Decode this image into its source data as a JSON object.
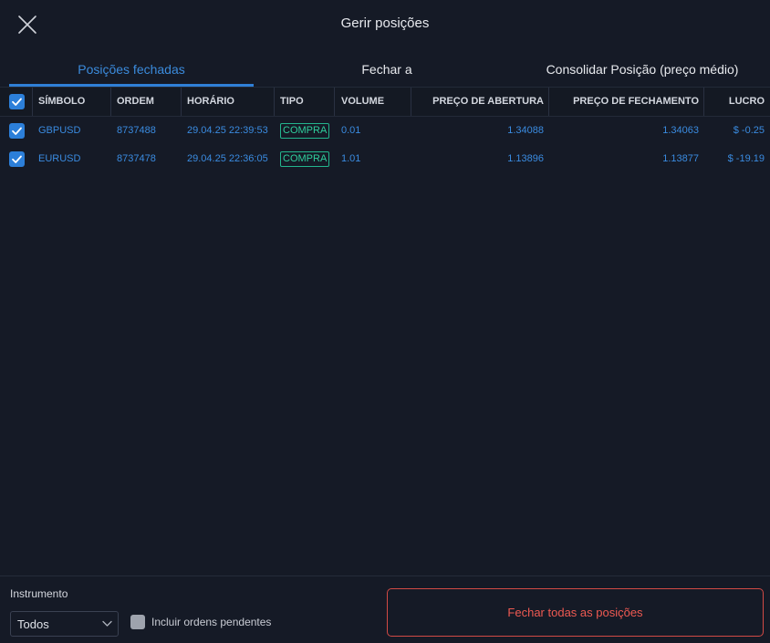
{
  "header": {
    "title": "Gerir posições",
    "close_icon": "close-icon"
  },
  "tabs": [
    {
      "label": "Posições fechadas",
      "active": true
    },
    {
      "label": "Fechar a",
      "active": false
    },
    {
      "label": "Consolidar Posição (preço médio)",
      "active": false
    }
  ],
  "table": {
    "columns": [
      "SÍMBOLO",
      "ORDEM",
      "HORÁRIO",
      "TIPO",
      "VOLUME",
      "PREÇO DE ABERTURA",
      "PREÇO DE FECHAMENTO",
      "LUCRO"
    ],
    "rows": [
      {
        "checked": true,
        "symbol": "GBPUSD",
        "order": "8737488",
        "time": "29.04.25 22:39:53",
        "type": "COMPRA",
        "volume": "0.01",
        "open_price": "1.34088",
        "close_price": "1.34063",
        "profit": "$ -0.25"
      },
      {
        "checked": true,
        "symbol": "EURUSD",
        "order": "8737478",
        "time": "29.04.25 22:36:05",
        "type": "COMPRA",
        "volume": "1.01",
        "open_price": "1.13896",
        "close_price": "1.13877",
        "profit": "$ -19.19"
      }
    ]
  },
  "footer": {
    "instrument_label": "Instrumento",
    "instrument_value": "Todos",
    "include_pending_label": "Incluir ordens pendentes",
    "include_pending_checked": false,
    "close_all_label": "Fechar todas as posições"
  },
  "colors": {
    "background": "#151a26",
    "accent": "#2f7fd6",
    "buy_badge": "#23b58d",
    "danger": "#d24a45"
  }
}
